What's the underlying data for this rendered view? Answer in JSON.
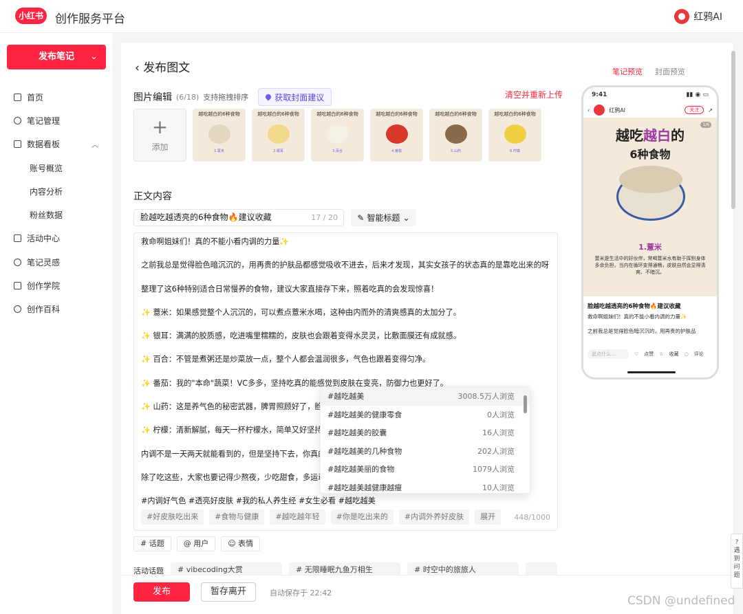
{
  "header": {
    "logo": "小红书",
    "app_title": "创作服务平台",
    "user": "红鸦AI"
  },
  "sidebar": {
    "publish_button": "发布笔记",
    "items": [
      {
        "label": "首页",
        "icon": "home-icon"
      },
      {
        "label": "笔记管理",
        "icon": "note-icon"
      },
      {
        "label": "数据看板",
        "icon": "chart-icon"
      },
      {
        "label": "账号概览",
        "sub": true
      },
      {
        "label": "内容分析",
        "sub": true
      },
      {
        "label": "粉丝数据",
        "sub": true
      },
      {
        "label": "活动中心",
        "icon": "activity-icon"
      },
      {
        "label": "笔记灵感",
        "icon": "inspiration-icon"
      },
      {
        "label": "创作学院",
        "icon": "academy-icon"
      },
      {
        "label": "创作百科",
        "icon": "wiki-icon"
      }
    ]
  },
  "page": {
    "title": "发布图文"
  },
  "image_edit": {
    "heading": "图片编辑",
    "count": "(6/18)",
    "hint": "支持拖拽排序",
    "cover_button": "获取封面建议",
    "clear_link": "清空并重新上传",
    "add_label": "添加",
    "thumb_title": "越吃越白的6种食物",
    "thumbs": [
      {
        "cap": "1.薏米",
        "color": "#e3d7c0"
      },
      {
        "cap": "2.银耳",
        "color": "#f1d88a"
      },
      {
        "cap": "3.百合",
        "color": "#f5f0e6"
      },
      {
        "cap": "4.番茄",
        "color": "#d8392a"
      },
      {
        "cap": "5.山药",
        "color": "#8a6a4a"
      },
      {
        "cap": "6.柠檬",
        "color": "#f0d040"
      }
    ]
  },
  "content": {
    "heading": "正文内容",
    "title_value": "脸越吃越透亮的6种食物🔥建议收藏",
    "title_count": "17 / 20",
    "smart_title": "智能标题",
    "lines": [
      "救命啊姐妹们！真的不能小看内调的力量✨",
      "之前我总是觉得脸色暗沉沉的，用再贵的护肤品都感觉吸收不进去，后来才发现，其实女孩子的状态真的是靠吃出来的呀！",
      "整理了这6种特别适合日常慢养的食物，建议大家直接存下来，照着吃真的会发现惊喜！",
      "✨ 薏米：如果感觉整个人沉沉的，可以煮点薏米水喝，这种由内而外的清爽感真的太加分了。",
      "✨ 银耳：满满的胶质感，吃进嘴里糯糯的，皮肤也会跟着变得水灵灵，比敷面膜还有成就感。",
      "✨ 百合：不管是煮粥还是炒菜放一点，整个人都会温润很多，气色也跟着变得匀净。",
      "✨ 番茄：我的\"本命\"蔬菜！VC多多，坚持吃真的能感觉到皮肤在变亮，防御力也更好了。",
      "✨ 山药：这是养气色的秘密武器，脾胃照顾好了，脸色",
      "✨ 柠檬：清新解腻，每天一杯柠檬水，简单又好坚持，",
      "内调不是一天两天就能看到的，但是坚持下去，你真的",
      "除了吃这些，大家也要记得少熬夜，少吃甜食，多运动"
    ],
    "hashtags": "#内调好气色 #透亮好皮肤 #我的私人养生经 #女生必看 #越吃越美",
    "chips": [
      "#好皮肤吃出来",
      "#食物与健康",
      "#越吃越年轻",
      "#你是吃出来的",
      "#内调外养好皮肤",
      "展开"
    ],
    "word_count": "448/1000"
  },
  "dropdown": [
    {
      "tag": "#越吃越美",
      "views": "3008.5万人浏览"
    },
    {
      "tag": "#越吃越美的健康零食",
      "views": "0人浏览"
    },
    {
      "tag": "#越吃越美的胶囊",
      "views": "16人浏览"
    },
    {
      "tag": "#越吃越美的几种食物",
      "views": "202人浏览"
    },
    {
      "tag": "#越吃越美丽的食物",
      "views": "1079人浏览"
    },
    {
      "tag": "#越吃越美越健康越瘦",
      "views": "10人浏览"
    }
  ],
  "tools": {
    "topic": "# 话题",
    "user": "@ 用户",
    "emoji": "☺ 表情"
  },
  "activity": {
    "label": "活动话题",
    "cards": [
      "# vibecoding大赏",
      "# 无限睡眠九鱼万相生",
      "# 时空中的旅旅人"
    ]
  },
  "footer": {
    "publish": "发布",
    "save": "暂存离开",
    "autosave": "自动保存于 22:42"
  },
  "preview": {
    "tabs": [
      "笔记预览",
      "封面预览"
    ],
    "time": "9:41",
    "account": "红鸦AI",
    "follow": "关注",
    "page": "1/6",
    "big_title_a": "越吃",
    "big_title_b": "越白",
    "big_title_c": "的",
    "big_title_2": "6种食物",
    "tag": "1.薏米",
    "desc": "薏米是生活中的好伙伴，常喝薏米水有助于挥别身体多余负担，当内在循环变得通畅，皮肤自然会显得清爽、不暗沉。",
    "title": "脸越吃越透亮的6种食物🔥建议收藏",
    "text1": "救命啊姐妹们！真的不能小看内调的力量✨",
    "text2": "之前我总是觉得脸色暗沉沉的，用再贵的护肤品",
    "comment": "说点什么...",
    "like": "点赞",
    "collect": "收藏",
    "reply": "评论"
  },
  "help": "遇到问题",
  "watermark": "CSDN @undefined"
}
